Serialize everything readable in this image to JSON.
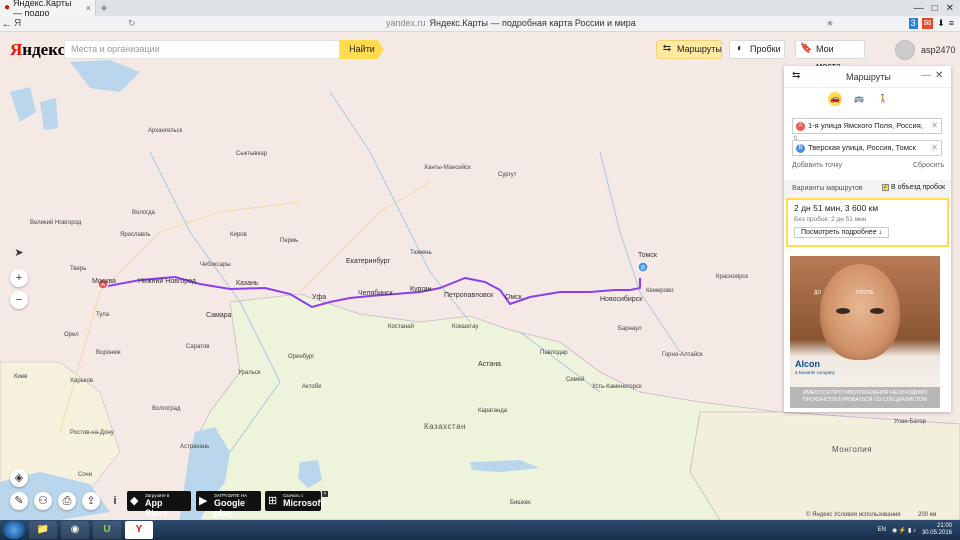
{
  "browser": {
    "tab_title": "Яндекс.Карты — подро",
    "tab_close": "×",
    "tab_plus": "+",
    "win_controls": [
      "—",
      "□",
      "✕"
    ],
    "back_icon": "←",
    "home_label": "Я",
    "domain": "yandex.ru",
    "page_title": "Яндекс.Карты — подробная карта России и мира",
    "star_icon": "★"
  },
  "header": {
    "logo_ya": "Я",
    "logo_rest": "ндекс",
    "search_placeholder": "Места и организации",
    "search_button": "Найти",
    "routes_button": "Маршруты",
    "traffic_button": "Пробки",
    "places_button": "Мои места",
    "username": "asp2470"
  },
  "map_controls": {
    "locate_icon": "➤",
    "zoom_in": "+",
    "zoom_out": "−",
    "layers_icon": "◈",
    "ruler_icon": "✎",
    "pano_icon": "⚇",
    "print_icon": "⎙",
    "share_icon": "⇪",
    "info_icon": "i"
  },
  "route_panel": {
    "title": "Маршруты",
    "minimize": "—",
    "close": "✕",
    "modes": [
      "car",
      "bus",
      "walk"
    ],
    "mode_glyphs": [
      "🚗",
      "🚌",
      "🚶"
    ],
    "point_a_letter": "A",
    "point_a": "1-я улица Ямского Поля, Россия,",
    "point_b_letter": "B",
    "point_b": "Тверская улица, Россия, Томск",
    "clear_icon": "✕",
    "add_point": "Добавить точку",
    "reset": "Сбросить",
    "variants_label": "Варианты маршрутов",
    "bypass_label": "В объезд пробок",
    "result_main": "2 дн 51 мин, 3 600 км",
    "result_sub": "Без пробок: 2 дн 51 мин",
    "details_button": "Посмотреть подробнее ↓",
    "ad_brand": "Alcon",
    "ad_brandsub": "a Novartis company",
    "ad_before": "ДО",
    "ad_after": "ПОСЛЕ",
    "ad_warning": "ИМЕЮТСЯ ПРОТИВОПОКАЗАНИЯ НЕОБХОДИМО ПРОКОНСУЛЬТИРОВАТЬСЯ СО СПЕЦИАЛИСТОМ"
  },
  "stores": [
    {
      "small": "Загрузите в",
      "big": "App Store",
      "icon": ""
    },
    {
      "small": "ЗАГРУЗИТЕ НА",
      "big": "Google play",
      "icon": "▶"
    },
    {
      "small": "Скачать с",
      "big": "Microsoft",
      "icon": "⊞"
    }
  ],
  "map_labels": {
    "cities": [
      {
        "t": "Москва",
        "big": true
      },
      {
        "t": "Нижний Новгород",
        "big": true
      },
      {
        "t": "Казань",
        "big": true
      },
      {
        "t": "Самара",
        "big": true
      },
      {
        "t": "Уфа",
        "big": true
      },
      {
        "t": "Челябинск",
        "big": true
      },
      {
        "t": "Екатеринбург",
        "big": true
      },
      {
        "t": "Курган",
        "big": true
      },
      {
        "t": "Петропавловск",
        "big": true
      },
      {
        "t": "Омск",
        "big": true
      },
      {
        "t": "Новосибирск",
        "big": true
      },
      {
        "t": "Томск",
        "big": true
      },
      {
        "t": "Кемерово",
        "big": false
      },
      {
        "t": "Барнаул",
        "big": false
      },
      {
        "t": "Красноярск",
        "big": false
      },
      {
        "t": "Астана",
        "big": true
      },
      {
        "t": "Сыктывкар",
        "big": false
      },
      {
        "t": "Ханты-Мансийск",
        "big": false
      },
      {
        "t": "Сургут",
        "big": false
      },
      {
        "t": "Тюмень",
        "big": false
      },
      {
        "t": "Пермь",
        "big": false
      },
      {
        "t": "Ярославль",
        "big": false
      },
      {
        "t": "Вологда",
        "big": false
      },
      {
        "t": "Киров",
        "big": false
      },
      {
        "t": "Чебоксары",
        "big": false
      },
      {
        "t": "Саратов",
        "big": false
      },
      {
        "t": "Оренбург",
        "big": false
      },
      {
        "t": "Воронеж",
        "big": false
      },
      {
        "t": "Тула",
        "big": false
      },
      {
        "t": "Орел",
        "big": false
      },
      {
        "t": "Киев",
        "big": false
      },
      {
        "t": "Харьков",
        "big": false
      },
      {
        "t": "Волгоград",
        "big": false
      },
      {
        "t": "Астрахань",
        "big": false
      },
      {
        "t": "Караганда",
        "big": false
      },
      {
        "t": "Павлодар",
        "big": false
      },
      {
        "t": "Костанай",
        "big": false
      },
      {
        "t": "Кокшетау",
        "big": false
      },
      {
        "t": "Семей",
        "big": false
      },
      {
        "t": "Усть-Каменогорск",
        "big": false
      },
      {
        "t": "Бишкек",
        "big": false
      },
      {
        "t": "Улан-Батор",
        "big": false
      },
      {
        "t": "Горно-Алтайск",
        "big": false
      },
      {
        "t": "Актобе",
        "big": false
      },
      {
        "t": "Уральск",
        "big": false
      },
      {
        "t": "Ростов-на-Дону",
        "big": false
      },
      {
        "t": "Сочи",
        "big": false
      },
      {
        "t": "Тверь",
        "big": false
      },
      {
        "t": "Великий Новгород",
        "big": false
      },
      {
        "t": "Архангельск",
        "big": false
      }
    ],
    "countries": [
      "Казахстан",
      "Монголия"
    ],
    "route_a": "A",
    "route_b": "B"
  },
  "footer": {
    "copyright": "© Яндекс  Условия использования",
    "scale": "200 км"
  },
  "taskbar": {
    "lang": "EN",
    "time": "21:00",
    "date": "30.05.2016",
    "apps": [
      "📁",
      "◉",
      "U",
      "Y"
    ]
  },
  "colors": {
    "route": "#8b3ff0",
    "accent": "#ffdb4d",
    "land_russia": "#f5e9e6",
    "land_kaz": "#eef3dc",
    "water": "#b9d6ec"
  }
}
